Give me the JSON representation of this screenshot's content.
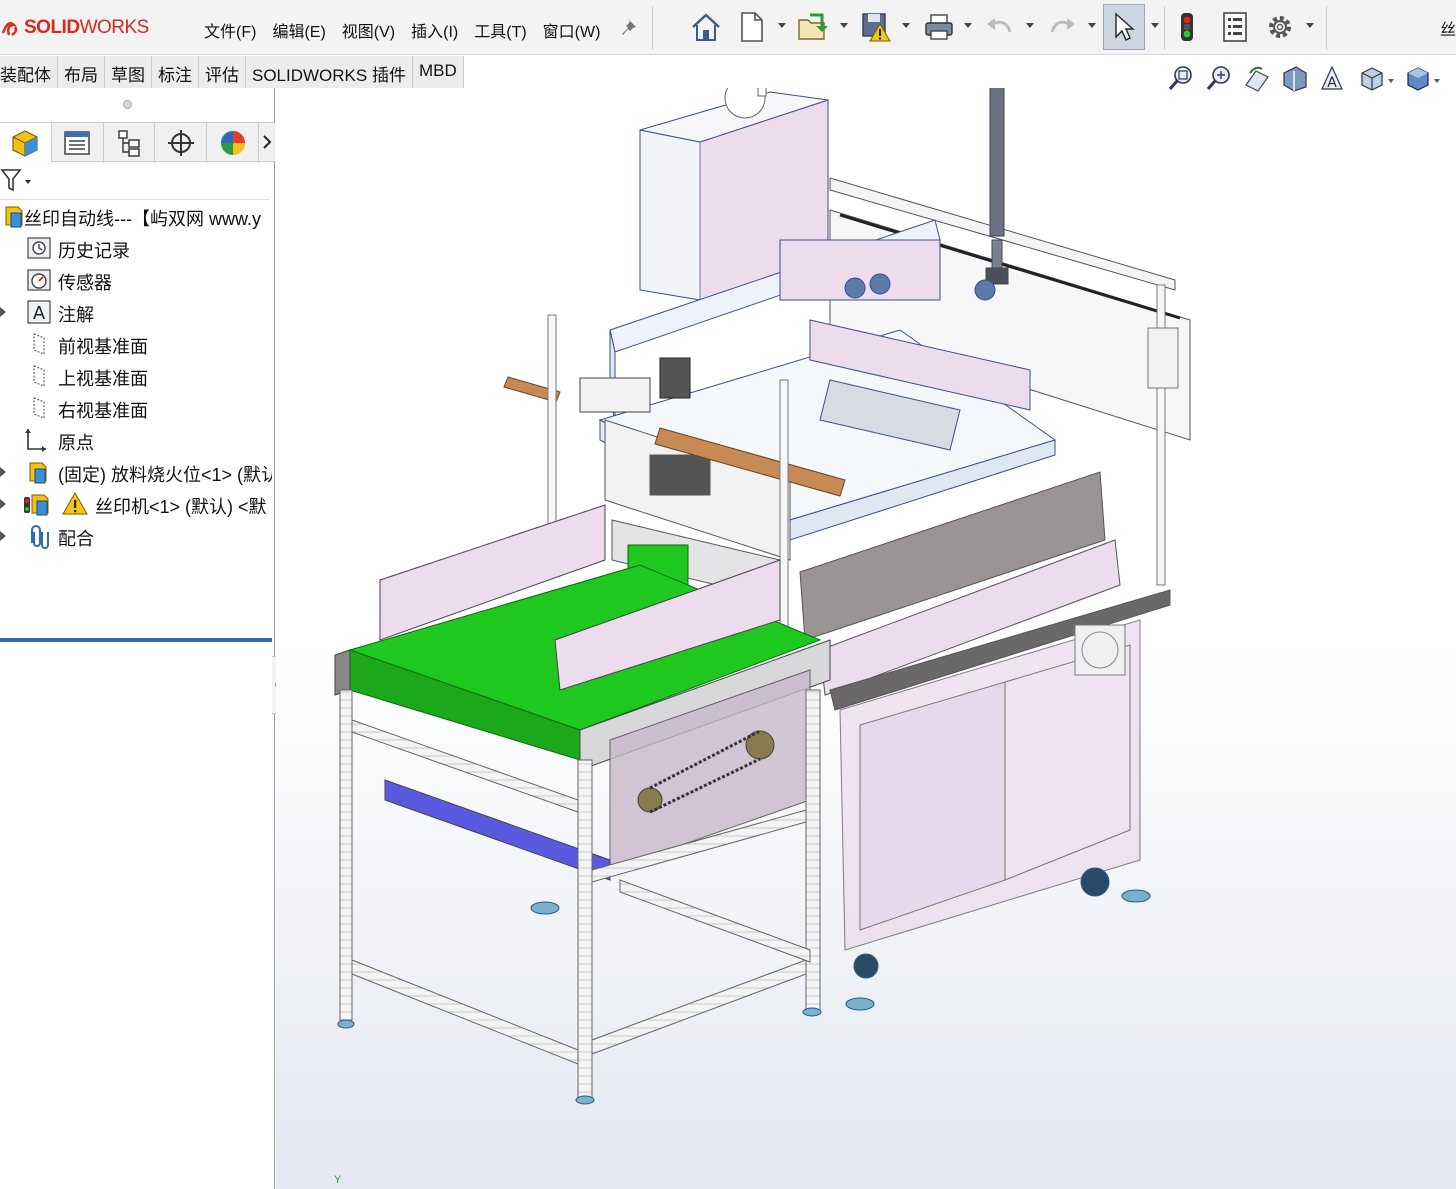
{
  "app": {
    "brand_bold": "SOLID",
    "brand_thin": "WORKS",
    "title_right": "丝"
  },
  "menu": [
    "文件(F)",
    "编辑(E)",
    "视图(V)",
    "插入(I)",
    "工具(T)",
    "窗口(W)"
  ],
  "tabs": [
    "装配体",
    "布局",
    "草图",
    "标注",
    "评估",
    "SOLIDWORKS 插件",
    "MBD"
  ],
  "tree": {
    "root": "丝印自动线---【屿双网 www.y",
    "items": [
      {
        "label": "历史记录",
        "icon": "history-icon",
        "expandable": false
      },
      {
        "label": "传感器",
        "icon": "sensor-icon",
        "expandable": false
      },
      {
        "label": "注解",
        "icon": "annotation-icon",
        "expandable": true
      },
      {
        "label": "前视基准面",
        "icon": "plane-icon",
        "expandable": false
      },
      {
        "label": "上视基准面",
        "icon": "plane-icon",
        "expandable": false
      },
      {
        "label": "右视基准面",
        "icon": "plane-icon",
        "expandable": false
      },
      {
        "label": "原点",
        "icon": "origin-icon",
        "expandable": false
      },
      {
        "label": "(固定) 放料烧火位<1> (默认",
        "icon": "subassembly-icon",
        "expandable": true
      },
      {
        "label": "丝印机<1> (默认) <默",
        "icon": "subassembly-warning-icon",
        "expandable": true
      },
      {
        "label": "配合",
        "icon": "mates-icon",
        "expandable": true
      }
    ]
  },
  "viewport": {
    "axis_label": "Y"
  },
  "colors": {
    "belt": "#1ec81e",
    "frame_tint": "#e8d8ee",
    "accent_blue": "#2f6bb4",
    "logo_red": "#d52b1e"
  }
}
